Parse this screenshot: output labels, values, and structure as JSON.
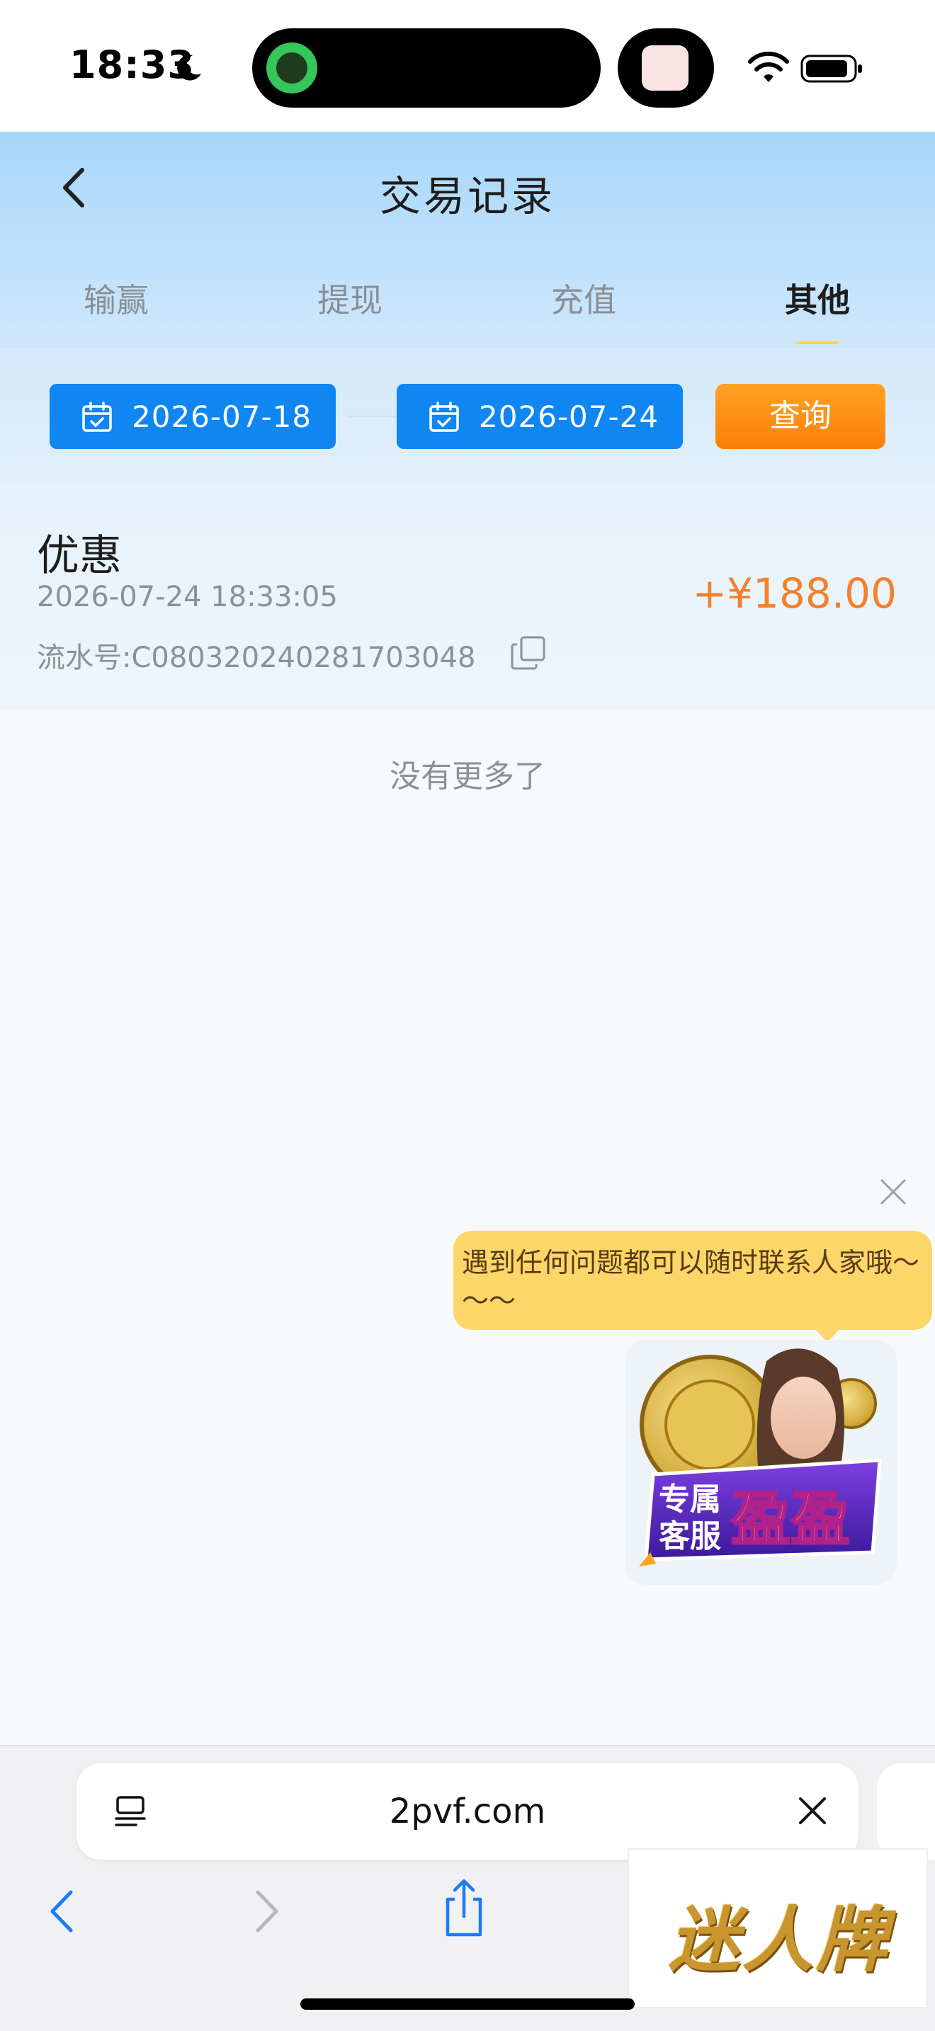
{
  "status_bar": {
    "time": "18:33",
    "icons": [
      "moon-icon",
      "wifi-icon",
      "battery-icon"
    ]
  },
  "header": {
    "title": "交易记录",
    "back_icon": "chevron-left-icon"
  },
  "tabs": [
    {
      "label": "输赢",
      "active": false
    },
    {
      "label": "提现",
      "active": false
    },
    {
      "label": "充值",
      "active": false
    },
    {
      "label": "其他",
      "active": true
    }
  ],
  "filter": {
    "start_date": "2026-07-18",
    "end_date": "2026-07-24",
    "query_label": "查询",
    "icon": "calendar-icon"
  },
  "records": [
    {
      "type": "优惠",
      "time": "2026-07-24 18:33:05",
      "serial": "流水号:C08032024028170304​8",
      "amount": "+¥188.00"
    }
  ],
  "no_more_text": "没有更多了",
  "service_widget": {
    "message": "遇到任何问题都可以随时联系人家哦～～～",
    "avatar_caption": "专属客服盈盈"
  },
  "browser": {
    "url": "2pvf.com"
  },
  "promo": {
    "text": "迷人牌"
  },
  "colors": {
    "accent_blue": "#0f86f1",
    "query_orange": "#fb7f0a",
    "amount_orange": "#f4802a",
    "tab_indicator": "#ffd54a",
    "bubble_yellow": "#fdd66a"
  }
}
